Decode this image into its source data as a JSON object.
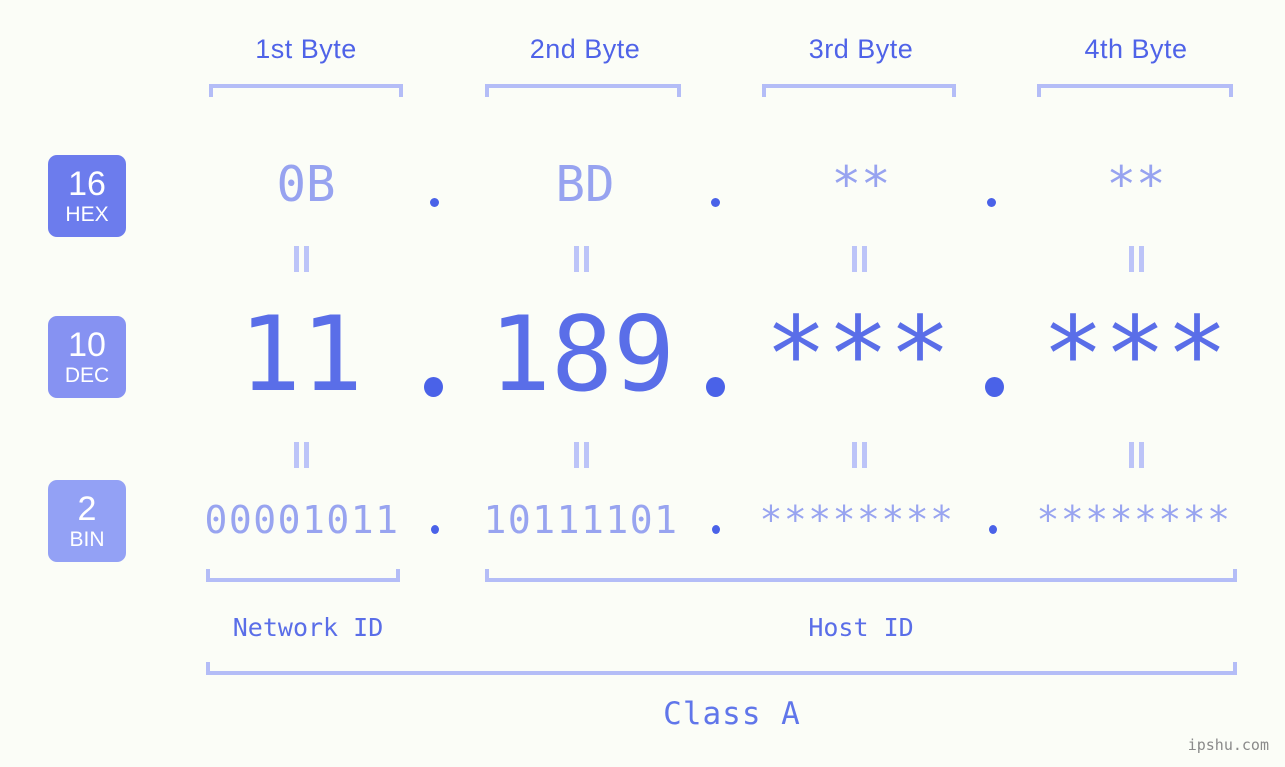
{
  "meta": {
    "background_color": "#fbfdf7",
    "accent_color": "#5a6ee8",
    "accent_light_color": "#b4bdf7",
    "watermark": "ipshu.com"
  },
  "byte_headers": [
    {
      "label": "1st Byte"
    },
    {
      "label": "2nd Byte"
    },
    {
      "label": "3rd Byte"
    },
    {
      "label": "4th Byte"
    }
  ],
  "rows": [
    {
      "badge": {
        "base": "16",
        "name": "HEX",
        "color": "#6c7ced"
      },
      "values": [
        "0B",
        "BD",
        "**",
        "**"
      ],
      "separator": "."
    },
    {
      "badge": {
        "base": "10",
        "name": "DEC",
        "color": "#8692f2"
      },
      "values": [
        "11",
        "189",
        "***",
        "***"
      ],
      "separator": "."
    },
    {
      "badge": {
        "base": "2",
        "name": "BIN",
        "color": "#93a1f5"
      },
      "values": [
        "00001011",
        "10111101",
        "********",
        "********"
      ],
      "separator": "."
    }
  ],
  "equality_symbol": "||",
  "id_sections": [
    {
      "label": "Network ID"
    },
    {
      "label": "Host ID"
    }
  ],
  "class": {
    "label": "Class A"
  }
}
